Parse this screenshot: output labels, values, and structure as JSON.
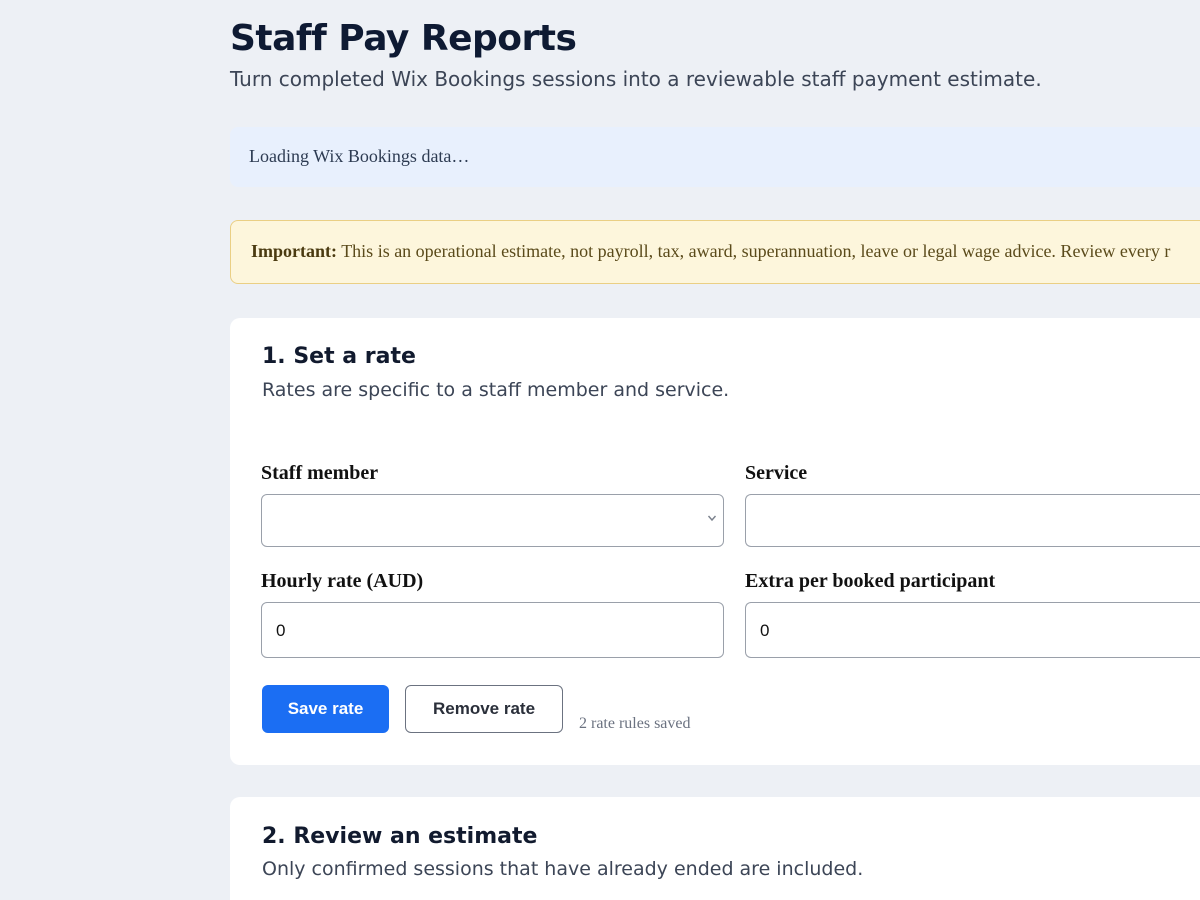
{
  "header": {
    "title": "Staff Pay Reports",
    "subtitle": "Turn completed Wix Bookings sessions into a reviewable staff payment estimate."
  },
  "loading": {
    "text": "Loading Wix Bookings data…"
  },
  "notice": {
    "label": "Important:",
    "text": "This is an operational estimate, not payroll, tax, award, superannuation, leave or legal wage advice. Review every r"
  },
  "rate_section": {
    "heading": "1. Set a rate",
    "description": "Rates are specific to a staff member and service.",
    "staff_label": "Staff member",
    "staff_value": "",
    "service_label": "Service",
    "service_value": "",
    "hourly_label": "Hourly rate (AUD)",
    "hourly_value": "0",
    "extra_label": "Extra per booked participant",
    "extra_value": "0",
    "save_button": "Save rate",
    "remove_button": "Remove rate",
    "status": "2 rate rules saved"
  },
  "review_section": {
    "heading": "2. Review an estimate",
    "description": "Only confirmed sessions that have already ended are included."
  },
  "icons": {
    "staff_select": "chevron-down-icon",
    "service_select": "chevron-down-icon"
  },
  "colors": {
    "primary": "#1b6ef3",
    "background": "#edf0f5",
    "notice_bg": "#fdf6dc",
    "loading_bg": "#e8f0fd"
  }
}
